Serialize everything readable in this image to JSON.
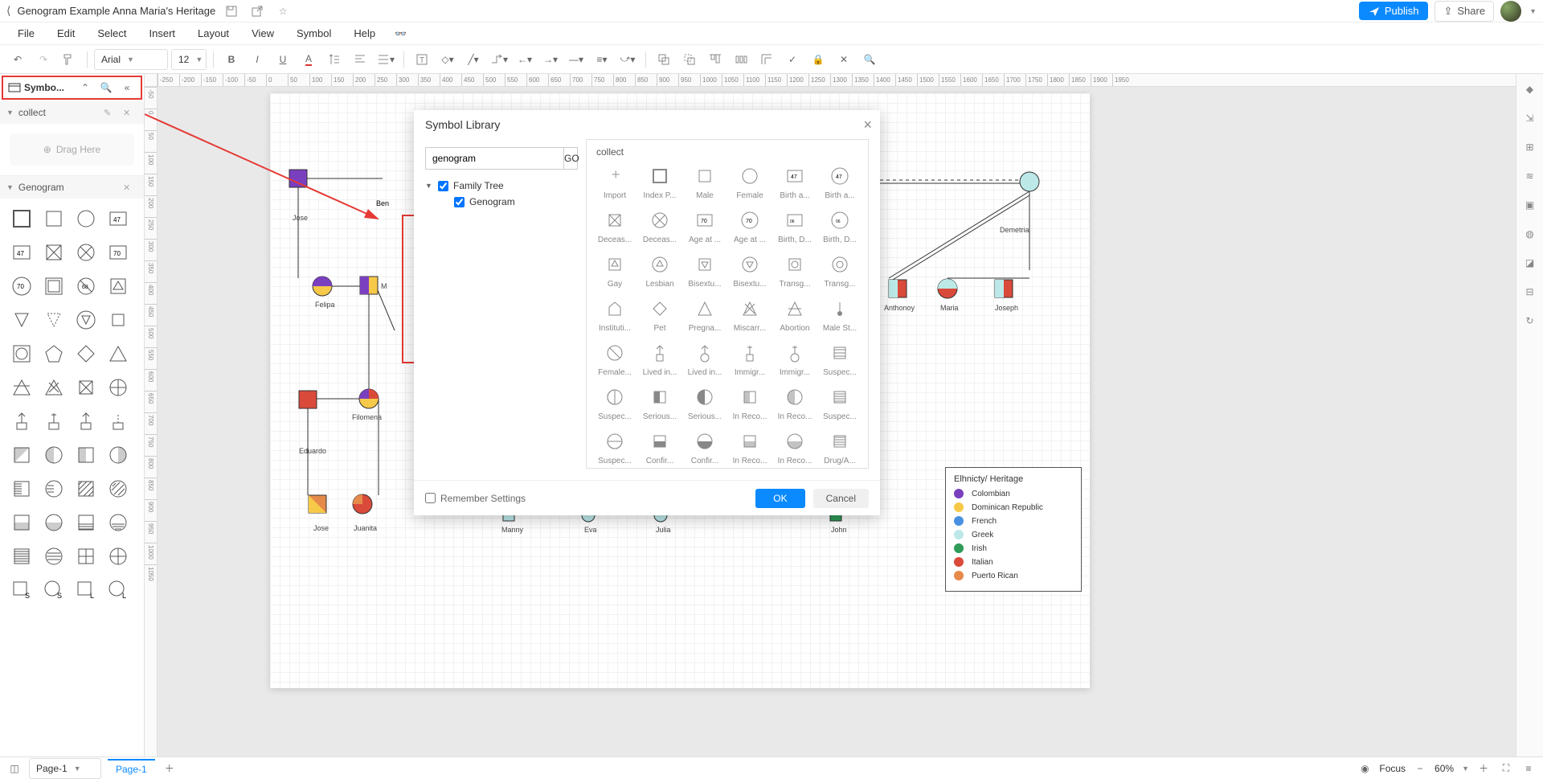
{
  "title": "Genogram Example Anna Maria's Heritage",
  "menubar": [
    "File",
    "Edit",
    "Select",
    "Insert",
    "Layout",
    "View",
    "Symbol",
    "Help"
  ],
  "font": "Arial",
  "fontsize": "12",
  "publish": "Publish",
  "share": "Share",
  "left": {
    "lib_label": "Symbo...",
    "collect": "collect",
    "drag_here": "Drag Here",
    "genogram": "Genogram"
  },
  "dialog": {
    "title": "Symbol Library",
    "search": "genogram",
    "go": "GO",
    "tree_parent": "Family Tree",
    "tree_child": "Genogram",
    "right_head": "collect",
    "symbols": [
      "Import",
      "Index P...",
      "Male",
      "Female",
      "Birth a...",
      "Birth a...",
      "Deceas...",
      "Deceas...",
      "Age at ...",
      "Age at ...",
      "Birth, D...",
      "Birth, D...",
      "Gay",
      "Lesbian",
      "Bisextu...",
      "Bisextu...",
      "Transg...",
      "Transg...",
      "Instituti...",
      "Pet",
      "Pregna...",
      "Miscarr...",
      "Abortion",
      "Male St...",
      "Female...",
      "Lived in...",
      "Lived in...",
      "Immigr...",
      "Immigr...",
      "Suspec...",
      "Suspec...",
      "Serious...",
      "Serious...",
      "In Reco...",
      "In Reco...",
      "Suspec...",
      "Suspec...",
      "Confir...",
      "Confir...",
      "In Reco...",
      "In Reco...",
      "Drug/A..."
    ],
    "remember": "Remember Settings",
    "ok": "OK",
    "cancel": "Cancel"
  },
  "canvas": {
    "names": {
      "jose": "Jose",
      "ben": "Ben",
      "felipa": "Felipa",
      "m": "M",
      "filomena": "Filomena",
      "eduardo": "Eduardo",
      "jose2": "Jose",
      "juanita": "Juanita",
      "manny": "Manny",
      "eva": "Eva",
      "julia": "Julia",
      "john": "John",
      "demetria": "Demetria",
      "anthonov": "Anthonoy",
      "maria": "Maria",
      "joseph": "Joseph"
    }
  },
  "legend": {
    "title": "Elhnicty/ Heritage",
    "items": [
      {
        "color": "#7a3fbf",
        "label": "Colombian"
      },
      {
        "color": "#f7c948",
        "label": "Dominican Republic"
      },
      {
        "color": "#4a90e2",
        "label": "French"
      },
      {
        "color": "#bce8e8",
        "label": "Greek"
      },
      {
        "color": "#2e9b58",
        "label": "Irish"
      },
      {
        "color": "#d94a3a",
        "label": "Italian"
      },
      {
        "color": "#e68a4a",
        "label": "Puerto Rican"
      }
    ]
  },
  "bottom": {
    "page_selector": "Page-1",
    "page_tab": "Page-1",
    "focus": "Focus",
    "zoom": "60%"
  },
  "ruler_h": [
    "-250",
    "-200",
    "-150",
    "-100",
    "-50",
    "0",
    "50",
    "100",
    "150",
    "200",
    "250",
    "300",
    "350",
    "400",
    "450",
    "500",
    "550",
    "600",
    "650",
    "700",
    "750",
    "800",
    "850",
    "900",
    "950",
    "1000",
    "1050",
    "1100",
    "1150",
    "1200",
    "1250",
    "1300",
    "1350",
    "1400",
    "1450",
    "1500",
    "1550",
    "1600",
    "1650",
    "1700",
    "1750",
    "1800",
    "1850",
    "1900",
    "1950"
  ],
  "ruler_v": [
    "-50",
    "0",
    "50",
    "100",
    "150",
    "200",
    "250",
    "300",
    "350",
    "400",
    "450",
    "500",
    "550",
    "600",
    "650",
    "700",
    "750",
    "800",
    "850",
    "900",
    "950",
    "1000",
    "1050"
  ]
}
